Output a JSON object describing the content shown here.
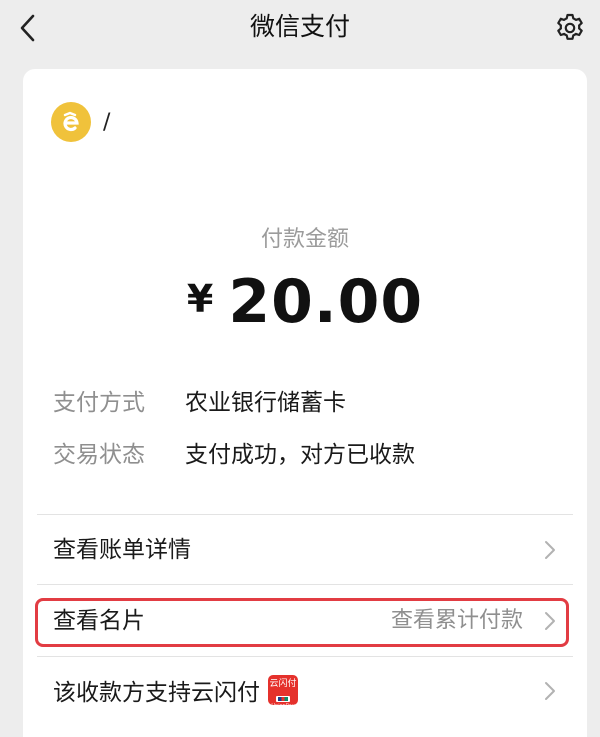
{
  "nav": {
    "title": "微信支付",
    "back_icon": "chevron-left-icon",
    "settings_icon": "gear-icon"
  },
  "merchant": {
    "name": "/",
    "logo_icon": "merchant-logo-icon"
  },
  "payment": {
    "amount_label": "付款金额",
    "currency_symbol": "¥",
    "amount": "20.00"
  },
  "details": [
    {
      "key": "支付方式",
      "value": "农业银行储蓄卡"
    },
    {
      "key": "交易状态",
      "value": "支付成功，对方已收款"
    }
  ],
  "menu": {
    "bill_details": "查看账单详情",
    "business_card": "查看名片",
    "cumulative_payment": "查看累计付款",
    "unionpay_support": "该收款方支持云闪付",
    "unionpay_badge": "云闪付",
    "unionpay_badge_sub": "UnionPay"
  },
  "colors": {
    "highlight": "#e23c43",
    "logo": "#f0c23b",
    "unionpay": "#e5312c"
  }
}
